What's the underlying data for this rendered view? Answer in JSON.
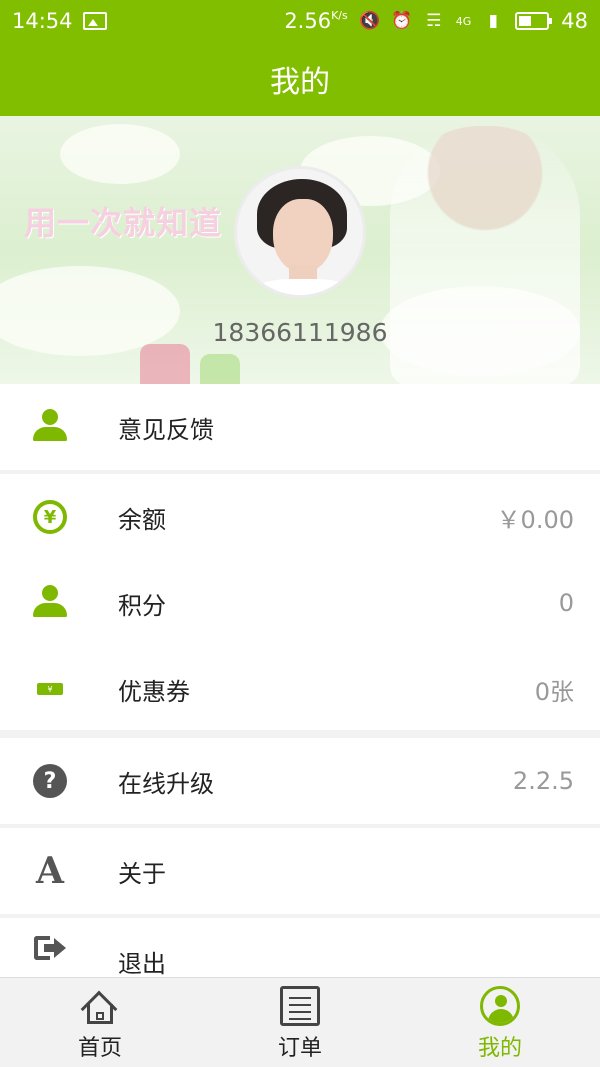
{
  "status_bar": {
    "time": "14:54",
    "speed": "2.56",
    "speed_unit": "K/s",
    "network": "4G",
    "battery": "48",
    "battery_level": 0.48
  },
  "header": {
    "title": "我的"
  },
  "profile": {
    "banner_slogan": "用一次就知道",
    "phone": "18366111986"
  },
  "menu": {
    "feedback": {
      "label": "意见反馈"
    },
    "balance": {
      "label": "余额",
      "value": "￥0.00"
    },
    "points": {
      "label": "积分",
      "value": "0"
    },
    "coupons": {
      "label": "优惠券",
      "value": "0张"
    },
    "upgrade": {
      "label": "在线升级",
      "value": "2.2.5"
    },
    "about": {
      "label": "关于"
    },
    "logout": {
      "label": "退出"
    }
  },
  "bottom_nav": {
    "tabs": [
      {
        "label": "首页",
        "icon": "home-icon"
      },
      {
        "label": "订单",
        "icon": "document-icon"
      },
      {
        "label": "我的",
        "icon": "user-circle-icon",
        "active": true
      }
    ]
  },
  "colors": {
    "accent": "#82be00",
    "icon_green": "#7fb800",
    "icon_gray": "#555555"
  }
}
